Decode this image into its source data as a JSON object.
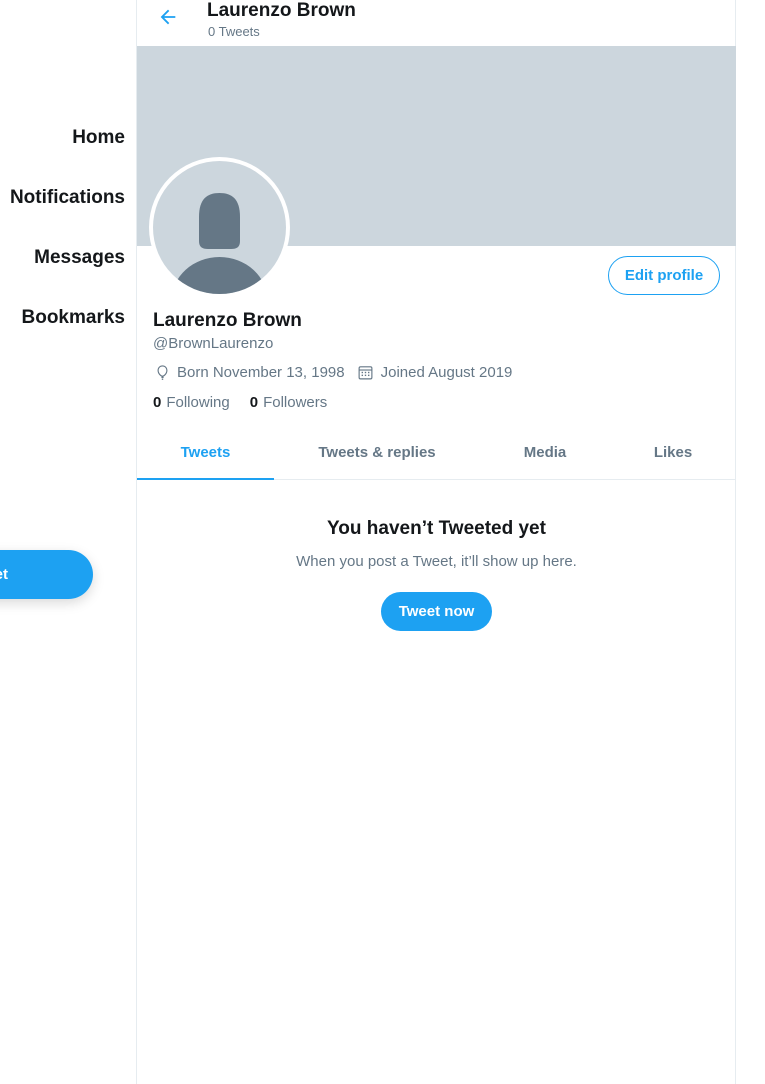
{
  "sidebar": {
    "items": [
      {
        "label": "Home",
        "icon": "home-icon"
      },
      {
        "label": "Notifications",
        "icon": "bell-icon"
      },
      {
        "label": "Messages",
        "icon": "envelope-icon"
      },
      {
        "label": "Bookmarks",
        "icon": "bookmark-icon"
      }
    ],
    "tweet_button": "Tweet"
  },
  "header": {
    "name": "Laurenzo Brown",
    "tweet_count": "0 Tweets",
    "back_icon": "arrow-left-icon"
  },
  "colors": {
    "accent": "#1da1f2",
    "banner": "#ccd6dd",
    "muted_text": "#657786",
    "avatar_silhouette": "#657786"
  },
  "profile": {
    "name": "Laurenzo Brown",
    "handle": "@BrownLaurenzo",
    "birth": "Born November 13, 1998",
    "joined": "Joined August 2019",
    "following_count": "0",
    "following_label": "Following",
    "followers_count": "0",
    "followers_label": "Followers",
    "edit_button": "Edit profile"
  },
  "tabs": [
    {
      "label": "Tweets",
      "active": true
    },
    {
      "label": "Tweets & replies",
      "active": false
    },
    {
      "label": "Media",
      "active": false
    },
    {
      "label": "Likes",
      "active": false
    }
  ],
  "empty_state": {
    "title": "You haven’t Tweeted yet",
    "subtitle": "When you post a Tweet, it’ll show up here.",
    "button": "Tweet now"
  }
}
